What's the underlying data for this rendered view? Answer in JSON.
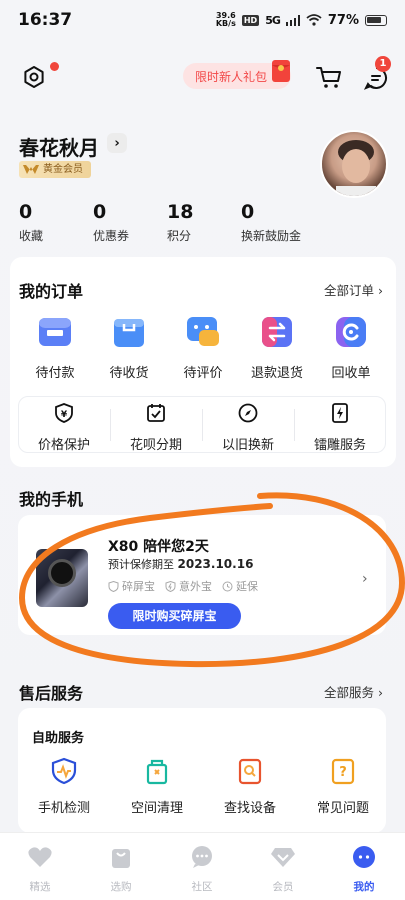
{
  "status_bar": {
    "time": "16:37",
    "net_speed_value": "39.6",
    "net_speed_unit": "KB/s",
    "hd": "HD",
    "signal": "5G",
    "battery": "77%"
  },
  "header": {
    "gift_label": "限时新人礼包",
    "message_badge": "1"
  },
  "profile": {
    "username": "春花秋月",
    "vip_label": "黄金会员",
    "stats": [
      {
        "value": "0",
        "label": "收藏"
      },
      {
        "value": "0",
        "label": "优惠券"
      },
      {
        "value": "18",
        "label": "积分"
      },
      {
        "value": "0",
        "label": "换新鼓励金"
      }
    ]
  },
  "orders": {
    "title": "我的订单",
    "more": "全部订单 ›",
    "items": [
      {
        "label": "待付款",
        "icon": "wallet-icon"
      },
      {
        "label": "待收货",
        "icon": "package-icon"
      },
      {
        "label": "待评价",
        "icon": "chat-review-icon"
      },
      {
        "label": "退款退货",
        "icon": "exchange-icon"
      },
      {
        "label": "回收单",
        "icon": "recycle-icon"
      }
    ],
    "services": [
      {
        "label": "价格保护",
        "icon": "price-shield-icon"
      },
      {
        "label": "花呗分期",
        "icon": "calendar-check-icon"
      },
      {
        "label": "以旧换新",
        "icon": "compass-icon"
      },
      {
        "label": "镭雕服务",
        "icon": "lightning-icon"
      }
    ]
  },
  "my_phone": {
    "title": "我的手机",
    "model_line": "X80 陪伴您2天",
    "warranty_prefix": "预计保修期至",
    "warranty_date": "2023.10.16",
    "tags": [
      "碎屏宝",
      "意外宝",
      "延保"
    ],
    "cta": "限时购买碎屏宝",
    "chevron": "›"
  },
  "after_sales": {
    "title": "售后服务",
    "more": "全部服务 ›",
    "self_service_title": "自助服务",
    "items": [
      {
        "label": "手机检测",
        "icon": "phone-check-icon"
      },
      {
        "label": "空间清理",
        "icon": "broom-icon"
      },
      {
        "label": "查找设备",
        "icon": "find-device-icon"
      },
      {
        "label": "常见问题",
        "icon": "faq-icon"
      }
    ]
  },
  "tabs": [
    {
      "label": "精选",
      "icon": "heart-icon",
      "active": false
    },
    {
      "label": "选购",
      "icon": "bag-icon",
      "active": false
    },
    {
      "label": "社区",
      "icon": "community-icon",
      "active": false
    },
    {
      "label": "会员",
      "icon": "diamond-icon",
      "active": false
    },
    {
      "label": "我的",
      "icon": "profile-icon",
      "active": true
    }
  ],
  "colors": {
    "accent": "#3a5cf0",
    "badge_red": "#f0463c",
    "annotation_orange": "#f27a1f"
  }
}
